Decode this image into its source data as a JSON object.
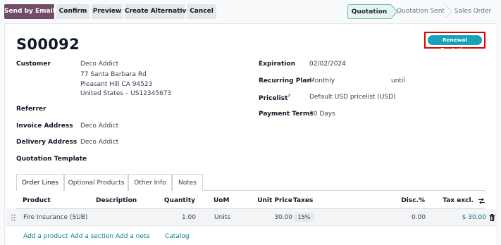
{
  "toolbar": {
    "send_by_email": "Send by Email",
    "confirm": "Confirm",
    "preview": "Preview",
    "create_alternative": "Create Alternative",
    "cancel": "Cancel"
  },
  "status": {
    "steps": [
      "Quotation",
      "Quotation Sent",
      "Sales Order"
    ],
    "active": "Quotation"
  },
  "record": {
    "name": "S00092",
    "badge": "Renewal Quotation",
    "badge_color": "#17a2b8"
  },
  "left_fields": {
    "customer_label": "Customer",
    "customer_name": "Deco Addict",
    "customer_addr1": "77 Santa Barbara Rd",
    "customer_addr2": "Pleasant Hill CA 94523",
    "customer_addr3": "United States – US12345673",
    "referrer_label": "Referrer",
    "invoice_label": "Invoice Address",
    "invoice_value": "Deco Addict",
    "delivery_label": "Delivery Address",
    "delivery_value": "Deco Addict",
    "template_label": "Quotation Template"
  },
  "right_fields": {
    "expiration_label": "Expiration",
    "expiration_value": "02/02/2024",
    "recurring_label": "Recurring Plan",
    "recurring_value": "Monthly",
    "recurring_until": "until",
    "pricelist_label": "Pricelist",
    "pricelist_help": "?",
    "pricelist_value": "Default USD pricelist (USD)",
    "payment_label": "Payment Terms",
    "payment_value": "30 Days"
  },
  "tabs": [
    "Order Lines",
    "Optional Products",
    "Other Info",
    "Notes"
  ],
  "table": {
    "headers": {
      "product": "Product",
      "description": "Description",
      "quantity": "Quantity",
      "uom": "UoM",
      "unit_price": "Unit Price",
      "taxes": "Taxes",
      "disc": "Disc.%",
      "tax_excl": "Tax excl."
    },
    "rows": [
      {
        "product": "Fire Insurance (SUB)",
        "description": "",
        "quantity": "1.00",
        "uom": "Units",
        "unit_price": "30.00",
        "taxes": "15%",
        "disc": "0.00",
        "tax_excl": "$ 30.00"
      }
    ],
    "actions": {
      "add_product": "Add a product",
      "add_section": "Add a section",
      "add_note": "Add a note",
      "catalog": "Catalog"
    }
  },
  "colors": {
    "primary": "#714b67",
    "accent": "#017e84",
    "highlight_box": "#e00000"
  }
}
